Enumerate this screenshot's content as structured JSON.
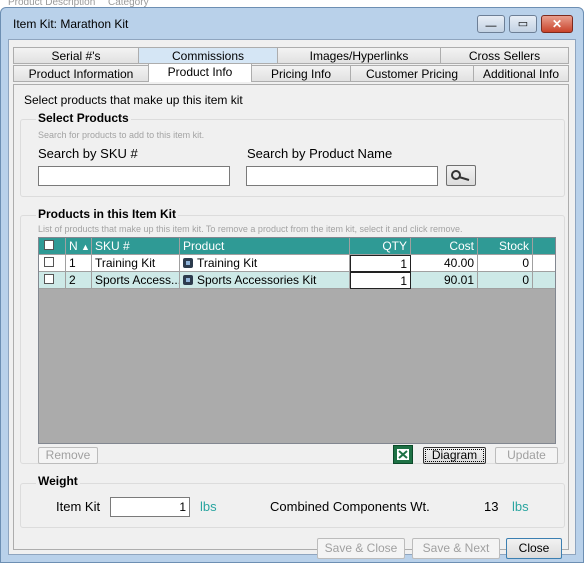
{
  "background_hint": {
    "left": "Product Description",
    "right": "Category"
  },
  "window": {
    "title": "Item Kit: Marathon Kit",
    "minimize": "—",
    "maximize": "▭",
    "close": "✕"
  },
  "tabs_row1": [
    "Serial #'s",
    "Commissions",
    "Images/Hyperlinks",
    "Cross Sellers"
  ],
  "tabs_row2": [
    "Product Information",
    "Product Info",
    "Pricing Info",
    "Customer Pricing",
    "Additional Info"
  ],
  "active_tab": "Product Info",
  "intro": "Select products that make up this item kit",
  "select_products": {
    "title": "Select Products",
    "hint": "Search for products to add to this item kit.",
    "sku_label": "Search by SKU #",
    "sku_value": "",
    "name_label": "Search by Product Name",
    "name_value": "",
    "search_icon": "search-icon"
  },
  "kit_products": {
    "title": "Products in this Item Kit",
    "hint": "List of products that make up this item kit. To remove a product from the item kit, select it and click remove.",
    "columns": {
      "num": "N",
      "sku": "SKU #",
      "product": "Product",
      "qty": "QTY",
      "cost": "Cost",
      "stock": "Stock"
    },
    "rows": [
      {
        "num": "1",
        "sku": "Training Kit",
        "product": "Training Kit",
        "qty": "1",
        "cost": "40.00",
        "stock": "0"
      },
      {
        "num": "2",
        "sku": "Sports Access...",
        "product": "Sports Accessories Kit",
        "qty": "1",
        "cost": "90.01",
        "stock": "0"
      }
    ],
    "buttons": {
      "remove": "Remove",
      "diagram": "Diagram",
      "update": "Update"
    },
    "excel_icon": "excel-icon"
  },
  "weight": {
    "title": "Weight",
    "item_kit_label": "Item Kit",
    "item_kit_value": "1",
    "unit": "lbs",
    "combined_label": "Combined Components Wt.",
    "combined_value": "13",
    "combined_unit": "lbs"
  },
  "footer": {
    "save_close": "Save & Close",
    "save_next": "Save & Next",
    "close": "Close"
  },
  "colors": {
    "grid_header": "#2f9a95",
    "grid_alt_row": "#cde9e7",
    "unit_text": "#2aa5a0",
    "window_frame": "#b9d1ea"
  }
}
